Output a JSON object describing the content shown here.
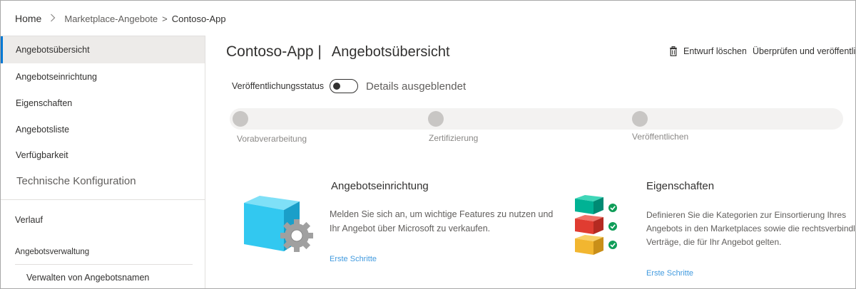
{
  "breadcrumb": {
    "home": "Home",
    "items": [
      "Marketplace-Angebote",
      "Contoso-App"
    ],
    "separator": ">"
  },
  "sidebar": {
    "items": [
      {
        "label": "Angebotsübersicht",
        "active": true
      },
      {
        "label": "Angebotseinrichtung"
      },
      {
        "label": "Eigenschaften"
      },
      {
        "label": "Angebotsliste"
      },
      {
        "label": "Verfügbarkeit"
      },
      {
        "label": "Technische Konfiguration"
      }
    ],
    "history": "Verlauf",
    "group_label": "Angebotsverwaltung",
    "sub_items": [
      {
        "label": "Verwalten von Angebotsnamen"
      }
    ]
  },
  "header": {
    "title": "Contoso-App |",
    "subtitle": "Angebotsübersicht",
    "actions": [
      {
        "label": "Entwurf löschen",
        "icon": "trash-icon"
      },
      {
        "label": "Überprüfen und veröffentlichen",
        "icon": "document-icon"
      }
    ]
  },
  "status": {
    "label": "Veröffentlichungsstatus",
    "toggle_on": false,
    "toggle_text": "Details ausgeblendet"
  },
  "progress": {
    "steps": [
      "Vorabverarbeitung",
      "Zertifizierung",
      "Veröffentlichen"
    ]
  },
  "cards": [
    {
      "title": "Angebotseinrichtung",
      "description": [
        "Melden Sie sich an, um wichtige Features zu nutzen und",
        "Ihr Angebot über Microsoft zu verkaufen."
      ],
      "link": "Erste Schritte",
      "icon": "cube-gear-icon"
    },
    {
      "title": "Eigenschaften",
      "description": [
        "Definieren Sie die Kategorien zur Einsortierung Ihres",
        "Angebots in den Marketplaces sowie die rechtsverbindlichen",
        "Verträge, die für Ihr Angebot gelten."
      ],
      "link": "Erste Schritte",
      "icon": "stacked-blocks-check-icon"
    }
  ],
  "colors": {
    "accent": "#0078d4",
    "cube": "#32c8f0",
    "gear": "#a0a0a0",
    "block_teal": "#00b294",
    "block_red": "#e03c31",
    "block_yellow": "#f2b630",
    "check": "#0f9d58"
  }
}
